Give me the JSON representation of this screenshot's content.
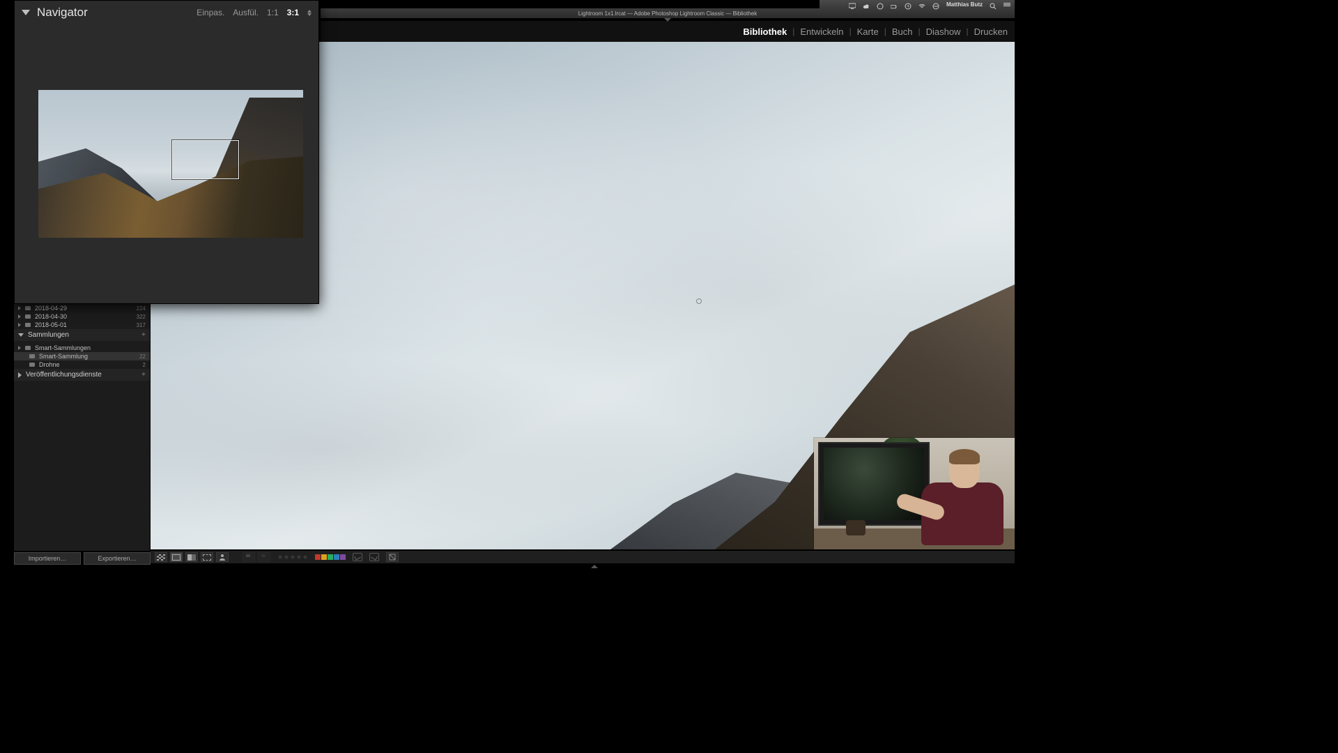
{
  "mac_menubar": {
    "user": "Matthias Butz"
  },
  "app_title": "Lightroom 1x1.lrcat — Adobe Photoshop Lightroom Classic — Bibliothek",
  "modules": {
    "bibliothek": "Bibliothek",
    "entwickeln": "Entwickeln",
    "karte": "Karte",
    "buch": "Buch",
    "diashow": "Diashow",
    "drucken": "Drucken"
  },
  "navigator": {
    "title": "Navigator",
    "zoom": {
      "fit": "Einpas.",
      "fill": "Ausfül.",
      "one": "1:1",
      "sel": "3:1"
    }
  },
  "folders": [
    {
      "name": "2018-04-29",
      "count": "224"
    },
    {
      "name": "2018-04-30",
      "count": "322"
    },
    {
      "name": "2018-05-01",
      "count": "317"
    }
  ],
  "collections": {
    "header": "Sammlungen",
    "items": [
      {
        "name": "Smart-Sammlungen",
        "count": ""
      },
      {
        "name": "Smart-Sammlung",
        "count": "22"
      },
      {
        "name": "Drohne",
        "count": "2"
      }
    ]
  },
  "publish": {
    "header": "Veröffentlichungsdienste"
  },
  "buttons": {
    "import": "Importieren…",
    "export": "Exportieren…"
  },
  "colors": {
    "swatch_red": "#c0392b",
    "swatch_yellow": "#d9a420",
    "swatch_green": "#27ae60",
    "swatch_blue": "#2d7fb8",
    "swatch_purple": "#7d4aa0"
  }
}
